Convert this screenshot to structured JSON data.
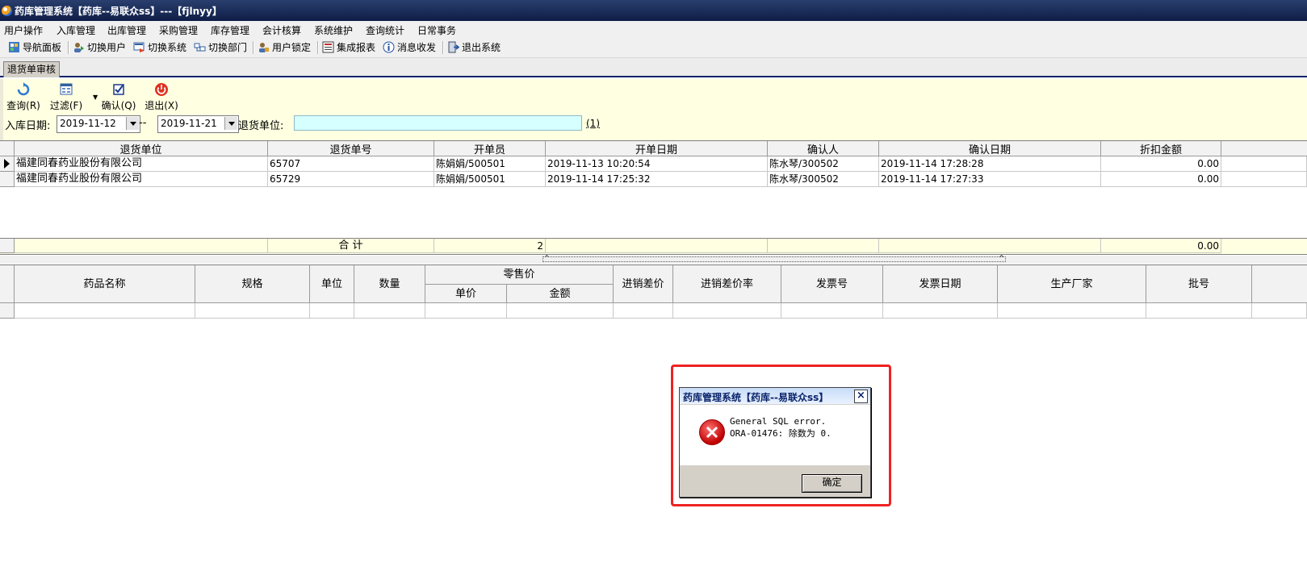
{
  "window": {
    "title": "药库管理系统【药库--易联众ss】---【fjlnyy】"
  },
  "menu": [
    "用户操作",
    "入库管理",
    "出库管理",
    "采购管理",
    "库存管理",
    "会计核算",
    "系统维护",
    "查询统计",
    "日常事务"
  ],
  "toolbar": [
    {
      "label": "导航面板",
      "icon": "navigation-panel-icon"
    },
    {
      "label": "切换用户",
      "icon": "switch-user-icon"
    },
    {
      "label": "切换系统",
      "icon": "switch-system-icon"
    },
    {
      "label": "切换部门",
      "icon": "switch-department-icon"
    },
    {
      "label": "用户锁定",
      "icon": "user-lock-icon"
    },
    {
      "label": "集成报表",
      "icon": "integrated-report-icon"
    },
    {
      "label": "消息收发",
      "icon": "message-icon"
    },
    {
      "label": "退出系统",
      "icon": "exit-system-icon"
    }
  ],
  "tab": {
    "label": "退货单审核"
  },
  "actions": [
    {
      "label": "查询(R)",
      "icon": "refresh-icon"
    },
    {
      "label": "过滤(F)",
      "icon": "filter-icon"
    },
    {
      "label": "确认(Q)",
      "icon": "checkbox-icon"
    },
    {
      "label": "退出(X)",
      "icon": "power-icon"
    }
  ],
  "filter": {
    "date_label": "入库日期:",
    "date_from": "2019-11-12",
    "date_sep": "--",
    "date_to": "2019-11-21",
    "unit_label": "退货单位:",
    "unit_value": "",
    "count": "(1)"
  },
  "top_grid": {
    "columns": [
      "退货单位",
      "退货单号",
      "开单员",
      "开单日期",
      "确认人",
      "确认日期",
      "折扣金额"
    ],
    "rows": [
      [
        "福建同春药业股份有限公司",
        "65707",
        "陈娟娟/500501",
        "2019-11-13 10:20:54",
        "陈水琴/300502",
        "2019-11-14 17:28:28",
        "0.00"
      ],
      [
        "福建同春药业股份有限公司",
        "65729",
        "陈娟娟/500501",
        "2019-11-14 17:25:32",
        "陈水琴/300502",
        "2019-11-14 17:27:33",
        "0.00"
      ]
    ],
    "total_label": "合  计",
    "total_count": "2",
    "total_amount": "0.00"
  },
  "bottom_grid": {
    "columns": [
      "药品名称",
      "规格",
      "单位",
      "数量",
      "零售价",
      "单价",
      "金额",
      "进销差价",
      "进销差价率",
      "发票号",
      "发票日期",
      "生产厂家",
      "批号"
    ]
  },
  "dialog": {
    "title": "药库管理系统【药库--易联众ss】",
    "line1": "General SQL error.",
    "line2": "ORA-01476: 除数为 0.",
    "ok": "确定"
  },
  "colors": {
    "accent_outline": "#ee2222",
    "titlebar": "#0e1d47",
    "content_bg": "#ffffe1",
    "input_bg": "#d6ffff"
  }
}
